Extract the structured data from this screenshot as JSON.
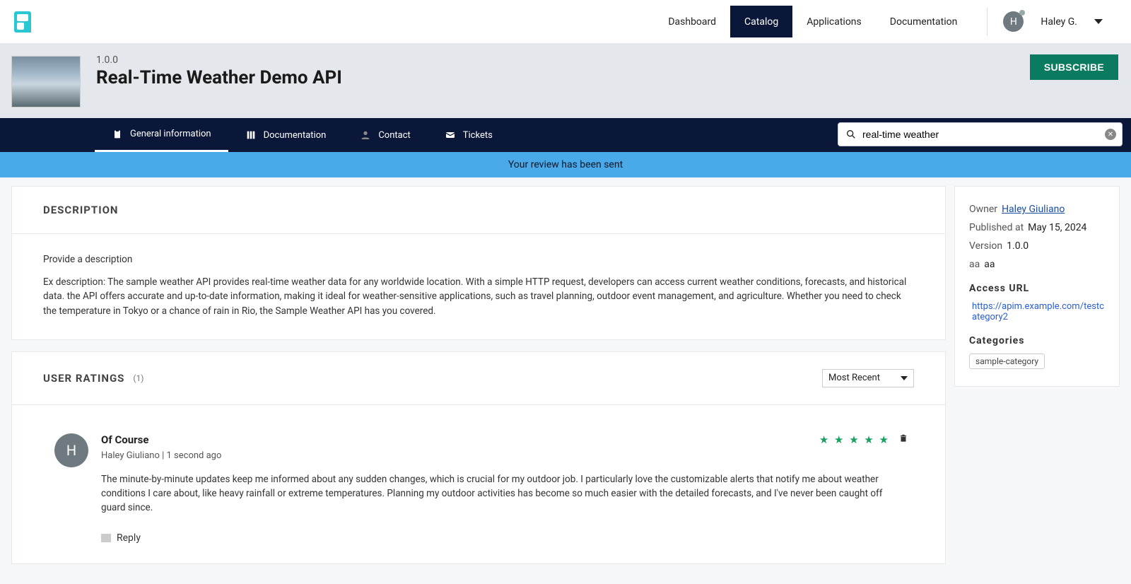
{
  "nav": {
    "dashboard": "Dashboard",
    "catalog": "Catalog",
    "applications": "Applications",
    "documentation": "Documentation",
    "user_initial": "H",
    "user_name": "Haley G."
  },
  "api": {
    "version": "1.0.0",
    "title": "Real-Time Weather Demo API",
    "subscribe_label": "SUBSCRIBE"
  },
  "subnav": {
    "general": "General information",
    "documentation": "Documentation",
    "contact": "Contact",
    "tickets": "Tickets",
    "search_value": "real-time weather"
  },
  "banner": {
    "message": "Your review has been sent"
  },
  "description": {
    "heading": "DESCRIPTION",
    "intro": "Provide a description",
    "body": "Ex description: The sample weather API provides real-time weather data for any worldwide location. With a simple HTTP request, developers can access current weather conditions, forecasts, and historical data. the API offers accurate and up-to-date information, making it ideal for weather-sensitive applications, such as travel planning, outdoor event management, and agriculture. Whether you need to check the temperature in Tokyo or a chance of rain in Rio, the Sample Weather API has you covered."
  },
  "ratings": {
    "heading": "USER RATINGS",
    "count": "(1)",
    "sort": "Most Recent"
  },
  "review": {
    "avatar_initial": "H",
    "title": "Of Course",
    "author": "Haley Giuliano",
    "sep": " | ",
    "time": "1 second ago",
    "stars": "★ ★ ★ ★ ★",
    "text": "The minute-by-minute updates keep me informed about any sudden changes, which is crucial for my outdoor job. I particularly love the customizable alerts that notify me about weather conditions I care about, like heavy rainfall or extreme temperatures. Planning my outdoor activities has become so much easier with the detailed forecasts, and I've never been caught off guard since.",
    "reply_label": "Reply"
  },
  "sidebar": {
    "owner_label": "Owner",
    "owner_value": "Haley Giuliano",
    "published_label": "Published at",
    "published_value": "May 15, 2024",
    "version_label": "Version",
    "version_value": "1.0.0",
    "aa_label": "aa",
    "aa_value": "aa",
    "access_url_heading": "Access URL",
    "access_url_value": "https://apim.example.com/testcategory2",
    "categories_heading": "Categories",
    "category_tag": "sample-category"
  }
}
